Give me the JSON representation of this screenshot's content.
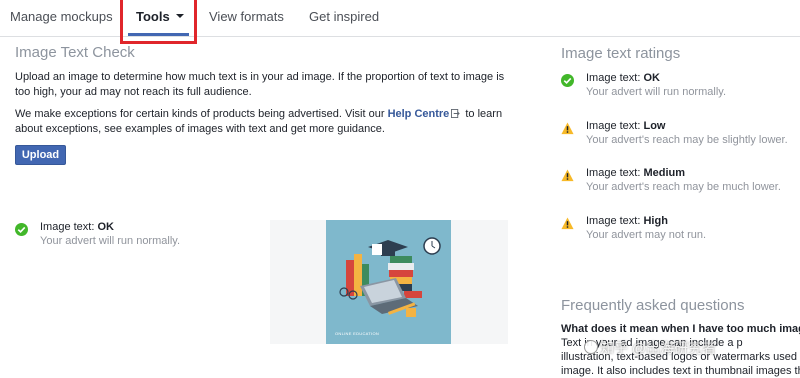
{
  "nav": {
    "tabs": [
      {
        "label": "Manage mockups"
      },
      {
        "label": "Tools"
      },
      {
        "label": "View formats"
      },
      {
        "label": "Get inspired"
      }
    ],
    "active_tab": "Tools"
  },
  "image_text_check": {
    "title": "Image Text Check",
    "paragraph1": "Upload an image to determine how much text is in your ad image. If the proportion of text to image is too high, your ad may not reach its full audience.",
    "paragraph2_before_link": "We make exceptions for certain kinds of products being advertised. Visit our ",
    "help_link": "Help Centre",
    "paragraph2_after_link": " to learn about exceptions, see examples of images with text and get more guidance.",
    "upload_button": "Upload",
    "result": {
      "label": "Image text: ",
      "level": "OK",
      "message": "Your advert will run normally."
    },
    "preview_caption": "ONLINE EDUCATION"
  },
  "ratings": {
    "title": "Image text ratings",
    "items": [
      {
        "label": "Image text: ",
        "level": "OK",
        "message": "Your advert will run normally.",
        "icon": "check-circle-icon"
      },
      {
        "label": "Image text: ",
        "level": "Low",
        "message": "Your advert's reach may be slightly lower.",
        "icon": "warning-icon"
      },
      {
        "label": "Image text: ",
        "level": "Medium",
        "message": "Your advert's reach may be much lower.",
        "icon": "warning-icon"
      },
      {
        "label": "Image text: ",
        "level": "High",
        "message": "Your advert may not run.",
        "icon": "warning-icon"
      }
    ]
  },
  "faq": {
    "title": "Frequently asked questions",
    "question": "What does it mean when I have too much image",
    "lines": [
      "Text in your ad image can include a p",
      "illustration, text-based logos or watermarks used in",
      "image. It also includes text in thumbnail images tha"
    ]
  },
  "watermark": "知乎 @出海研究者",
  "colors": {
    "accent": "#4267b2",
    "ok_green": "#42b72a",
    "warning_yellow": "#f7b928",
    "highlight_red": "#e0262b"
  }
}
